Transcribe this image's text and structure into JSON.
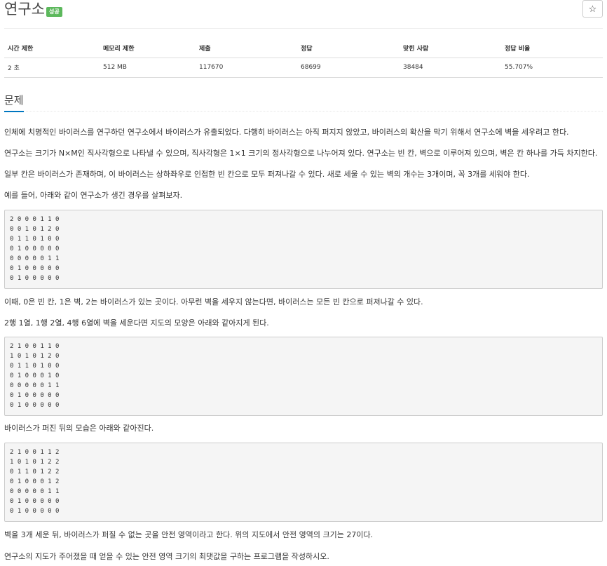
{
  "header": {
    "title": "연구소",
    "badge": "성공",
    "star": "☆"
  },
  "info": {
    "headers": [
      "시간 제한",
      "메모리 제한",
      "제출",
      "정답",
      "맞힌 사람",
      "정답 비율"
    ],
    "values": [
      "2 초",
      "512 MB",
      "117670",
      "68699",
      "38484",
      "55.707%"
    ]
  },
  "section": {
    "title": "문제"
  },
  "paragraphs": [
    "인체에 치명적인 바이러스를 연구하던 연구소에서 바이러스가 유출되었다. 다행히 바이러스는 아직 퍼지지 않았고, 바이러스의 확산을 막기 위해서 연구소에 벽을 세우려고 한다.",
    "연구소는 크기가 N×M인 직사각형으로 나타낼 수 있으며, 직사각형은 1×1 크기의 정사각형으로 나누어져 있다. 연구소는 빈 칸, 벽으로 이루어져 있으며, 벽은 칸 하나를 가득 차지한다.",
    "일부 칸은 바이러스가 존재하며, 이 바이러스는 상하좌우로 인접한 빈 칸으로 모두 퍼져나갈 수 있다. 새로 세울 수 있는 벽의 개수는 3개이며, 꼭 3개를 세워야 한다.",
    "예를 들어, 아래와 같이 연구소가 생긴 경우를 살펴보자.",
    "이때, 0은 빈 칸, 1은 벽, 2는 바이러스가 있는 곳이다. 아무런 벽을 세우지 않는다면, 바이러스는 모든 빈 칸으로 퍼져나갈 수 있다.",
    "2행 1열, 1행 2열, 4행 6열에 벽을 세운다면 지도의 모양은 아래와 같아지게 된다.",
    "바이러스가 퍼진 뒤의 모습은 아래와 같아진다.",
    "벽을 3개 세운 뒤, 바이러스가 퍼질 수 없는 곳을 안전 영역이라고 한다. 위의 지도에서 안전 영역의 크기는 27이다.",
    "연구소의 지도가 주어졌을 때 얻을 수 있는 안전 영역 크기의 최댓값을 구하는 프로그램을 작성하시오."
  ],
  "grids": [
    [
      "2 0 0 0 1 1 0",
      "0 0 1 0 1 2 0",
      "0 1 1 0 1 0 0",
      "0 1 0 0 0 0 0",
      "0 0 0 0 0 1 1",
      "0 1 0 0 0 0 0",
      "0 1 0 0 0 0 0"
    ],
    [
      "2 1 0 0 1 1 0",
      "1 0 1 0 1 2 0",
      "0 1 1 0 1 0 0",
      "0 1 0 0 0 1 0",
      "0 0 0 0 0 1 1",
      "0 1 0 0 0 0 0",
      "0 1 0 0 0 0 0"
    ],
    [
      "2 1 0 0 1 1 2",
      "1 0 1 0 1 2 2",
      "0 1 1 0 1 2 2",
      "0 1 0 0 0 1 2",
      "0 0 0 0 0 1 1",
      "0 1 0 0 0 0 0",
      "0 1 0 0 0 0 0"
    ]
  ]
}
